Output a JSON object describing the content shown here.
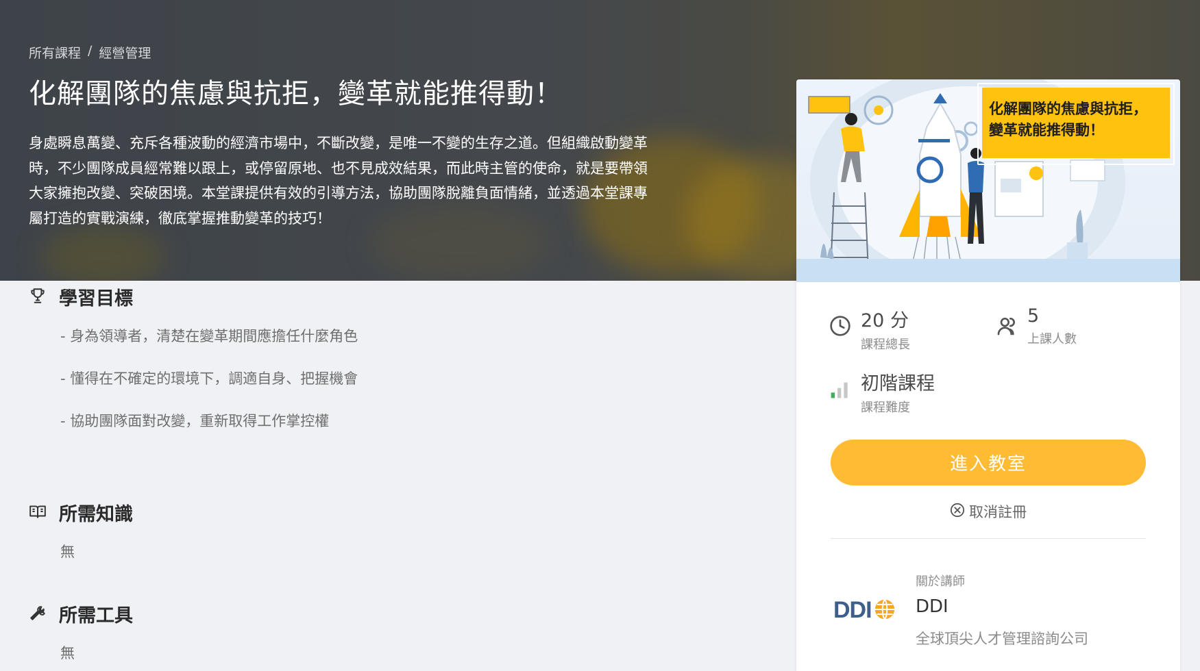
{
  "breadcrumb": {
    "root": "所有課程",
    "separator": "/",
    "category": "經營管理"
  },
  "course": {
    "title": "化解團隊的焦慮與抗拒，變革就能推得動！",
    "description_lines": [
      "身處瞬息萬變、充斥各種波動的經濟市場中，不斷改變，是唯一不變的生存之道。但組織啟動變革",
      "時，不少團隊成員經常難以跟上，或停留原地、也不見成效結果，而此時主管的使命，就是要帶領",
      "大家擁抱改變、突破困境。本堂課提供有效的引導方法，協助團隊脫離負面情緒，並透過本堂課專",
      "屬打造的實戰演練，徹底掌握推動變革的技巧！"
    ]
  },
  "learning_goals": {
    "title": "學習目標",
    "icon": "trophy-icon",
    "items": [
      "- 身為領導者，清楚在變革期間應擔任什麼角色",
      "- 懂得在不確定的環境下，調適自身、把握機會",
      "- 協助團隊面對改變，重新取得工作掌控權"
    ]
  },
  "prerequisites": {
    "title": "所需知識",
    "icon": "book-icon",
    "value": "無"
  },
  "tools": {
    "title": "所需工具",
    "icon": "wrench-icon",
    "value": "無"
  },
  "banner": {
    "line1": "化解團隊的焦慮與抗拒，",
    "line2": "變革就能推得動！",
    "accent": "#ffc20e"
  },
  "stats": {
    "duration": {
      "value": "20 分",
      "label": "課程總長",
      "icon": "clock-icon"
    },
    "students": {
      "value": "5",
      "label": "上課人數",
      "icon": "users-icon"
    },
    "level": {
      "value": "初階課程",
      "label": "課程難度",
      "icon": "level-bars-icon"
    }
  },
  "actions": {
    "enter_label": "進入教室",
    "cancel_label": "取消註冊",
    "accent": "#ffbb33"
  },
  "instructor": {
    "section_label": "關於講師",
    "logo_text": "DDI",
    "name": "DDI",
    "description": "全球頂尖人才管理諮詢公司"
  }
}
